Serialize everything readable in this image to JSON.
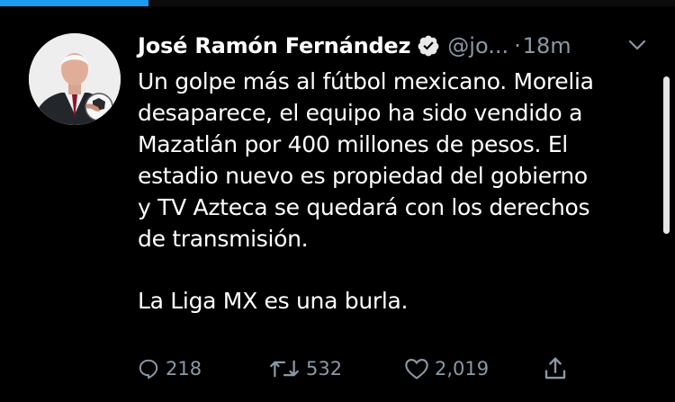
{
  "progress": {
    "fraction": 0.22,
    "color": "#1d9bf0"
  },
  "tweet": {
    "author": {
      "name": "José Ramón Fernández",
      "handle": "@jo...",
      "verified": true,
      "avatar_icon": "person-with-soccer-ball-photo"
    },
    "separator": "·",
    "time": "18m",
    "menu_icon": "chevron-down-icon",
    "text_lines": [
      "Un golpe más al fútbol mexicano. Morelia",
      "desaparece, el equipo ha sido vendido a",
      "Mazatlán por 400 millones de pesos. El",
      "estadio nuevo es propiedad del gobierno",
      "y TV Azteca se quedará con los derechos",
      "de transmisión."
    ],
    "text_last": "La Liga MX es una burla.",
    "actions": {
      "reply": {
        "icon": "reply-icon",
        "count": "218"
      },
      "retweet": {
        "icon": "retweet-icon",
        "count": "532"
      },
      "like": {
        "icon": "heart-icon",
        "count": "2,019"
      },
      "share": {
        "icon": "share-icon"
      }
    }
  },
  "colors": {
    "background": "#000000",
    "text": "#ffffff",
    "muted": "#8b98a5"
  }
}
